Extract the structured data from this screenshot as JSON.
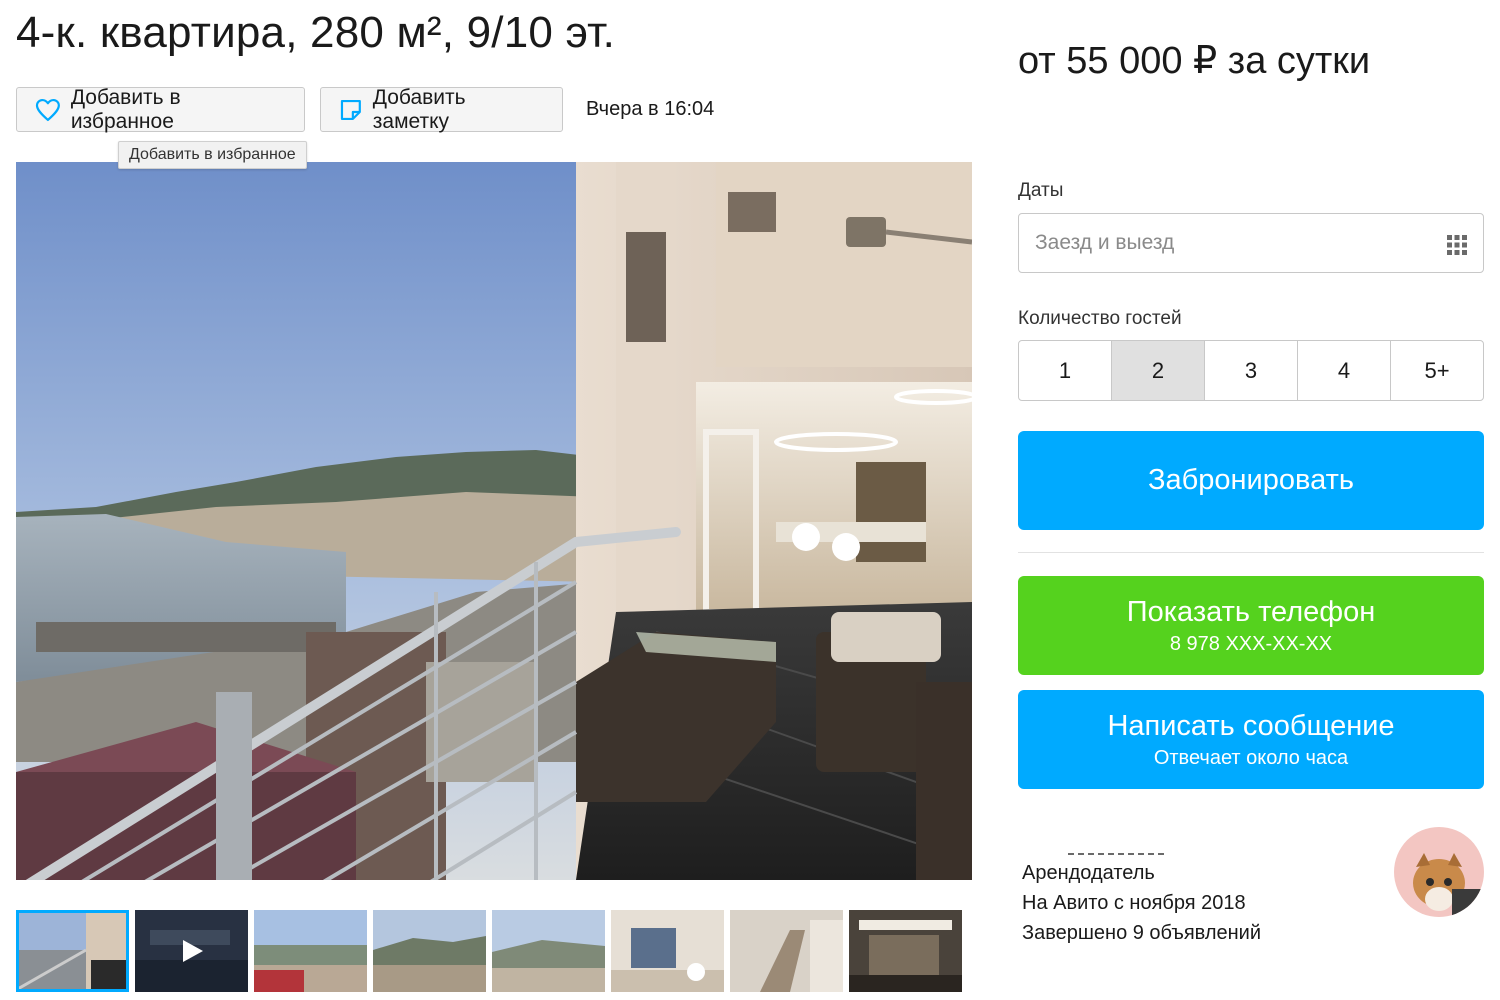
{
  "listing": {
    "title": "4-к. квартира, 280 м², 9/10 эт.",
    "price": "от 55 000 ₽ за сутки",
    "favorite_label": "Добавить в избранное",
    "note_label": "Добавить заметку",
    "posted": "Вчера в 16:04",
    "tooltip": "Добавить в избранное"
  },
  "gallery": {
    "thumbnail_count": 8,
    "active_index": 0,
    "video_index": 1
  },
  "booking": {
    "dates_label": "Даты",
    "dates_placeholder": "Заезд и выезд",
    "guests_label": "Количество гостей",
    "guest_options": [
      "1",
      "2",
      "3",
      "4",
      "5+"
    ],
    "selected_guests": "2",
    "book_label": "Забронировать"
  },
  "contact": {
    "phone_label": "Показать телефон",
    "phone_number": "8 978 XXX-XX-XX",
    "message_label": "Написать сообщение",
    "message_sub": "Отвечает около часа"
  },
  "seller": {
    "role": "Арендодатель",
    "since": "На Авито с ноября 2018",
    "completed": "Завершено 9 объявлений"
  },
  "colors": {
    "accent_blue": "#00aaff",
    "accent_green": "#55d21e",
    "selected_option": "#e0e0e0"
  },
  "icons": [
    "heart-icon",
    "note-icon",
    "calendar-grid-icon",
    "play-icon"
  ]
}
